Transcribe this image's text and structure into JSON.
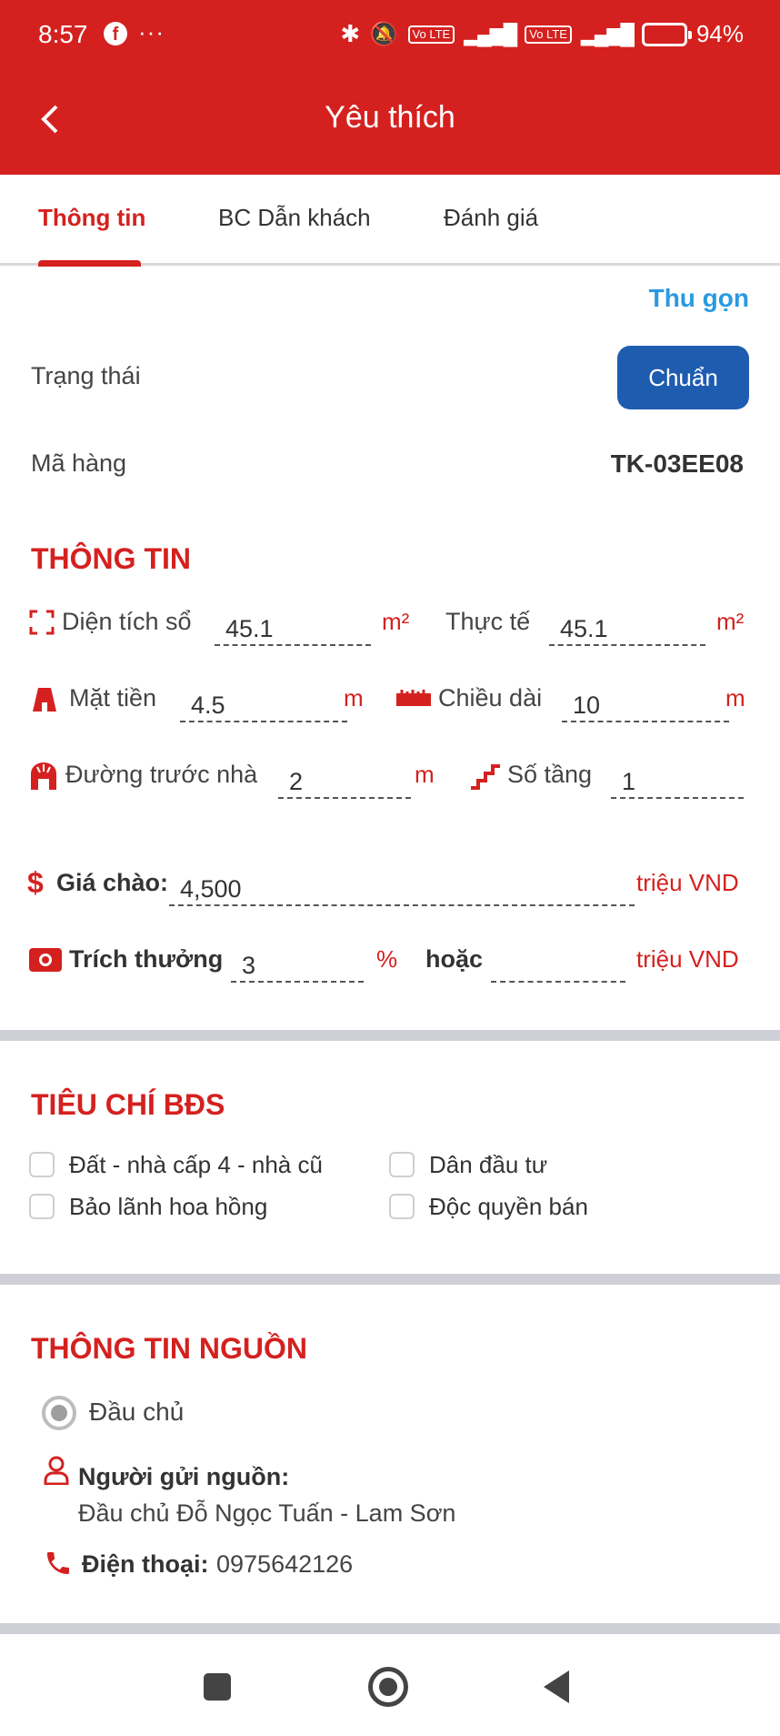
{
  "status_bar": {
    "time": "8:57",
    "dots": "···",
    "network1": "4G",
    "volte": "Vo LTE",
    "battery": "94%",
    "battery_level": 0.94
  },
  "app_bar": {
    "title": "Yêu thích"
  },
  "tabs": [
    {
      "label": "Thông tin",
      "active": true
    },
    {
      "label": "BC Dẫn khách",
      "active": false
    },
    {
      "label": "Đánh giá",
      "active": false
    }
  ],
  "summary": {
    "collapse_label": "Thu gọn",
    "status_label": "Trạng thái",
    "status_value": "Chuẩn",
    "code_label": "Mã hàng",
    "code_value": "TK-03EE08"
  },
  "info": {
    "title": "THÔNG TIN",
    "area_doc_label": "Diện tích sổ",
    "area_doc_value": "45.1",
    "area_doc_unit": "m²",
    "area_real_label": "Thực tế",
    "area_real_value": "45.1",
    "area_real_unit": "m²",
    "frontage_label": "Mặt tiền",
    "frontage_value": "4.5",
    "frontage_unit": "m",
    "length_label": "Chiều dài",
    "length_value": "10",
    "length_unit": "m",
    "road_label": "Đường trước nhà",
    "road_value": "2",
    "road_unit": "m",
    "floors_label": "Số tầng",
    "floors_value": "1",
    "price_label": "Giá chào:",
    "price_value": "4,500",
    "price_unit": "triệu VND",
    "bonus_label": "Trích thưởng",
    "bonus_value": "3",
    "bonus_unit": "%",
    "or_label": "hoặc",
    "bonus_alt_value": "",
    "bonus_alt_unit": "triệu VND"
  },
  "criteria": {
    "title": "TIÊU CHÍ BĐS",
    "items": [
      {
        "label": "Đất - nhà cấp 4 - nhà cũ",
        "checked": false
      },
      {
        "label": "Dân đầu tư",
        "checked": false
      },
      {
        "label": "Bảo lãnh hoa hồng",
        "checked": false
      },
      {
        "label": "Độc quyền bán",
        "checked": false
      }
    ]
  },
  "source": {
    "title": "THÔNG TIN NGUỒN",
    "radio_label": "Đầu chủ",
    "sender_label": "Người gửi nguồn:",
    "sender_value": "Đầu chủ Đỗ Ngọc Tuấn - Lam Sơn",
    "phone_label": "Điện thoại:",
    "phone_value": "0975642126"
  },
  "icons": {
    "back": "back-arrow-icon",
    "area": "area-corners-icon",
    "frontage": "building-front-icon",
    "length": "ruler-icon",
    "road": "road-icon",
    "floors": "stairs-icon",
    "price": "dollar-icon",
    "bonus": "money-icon",
    "person": "person-icon",
    "phone": "phone-icon"
  },
  "colors": {
    "brand_red": "#d4211f",
    "button_blue": "#1e5cb0",
    "link_blue": "#2a9ae0"
  }
}
